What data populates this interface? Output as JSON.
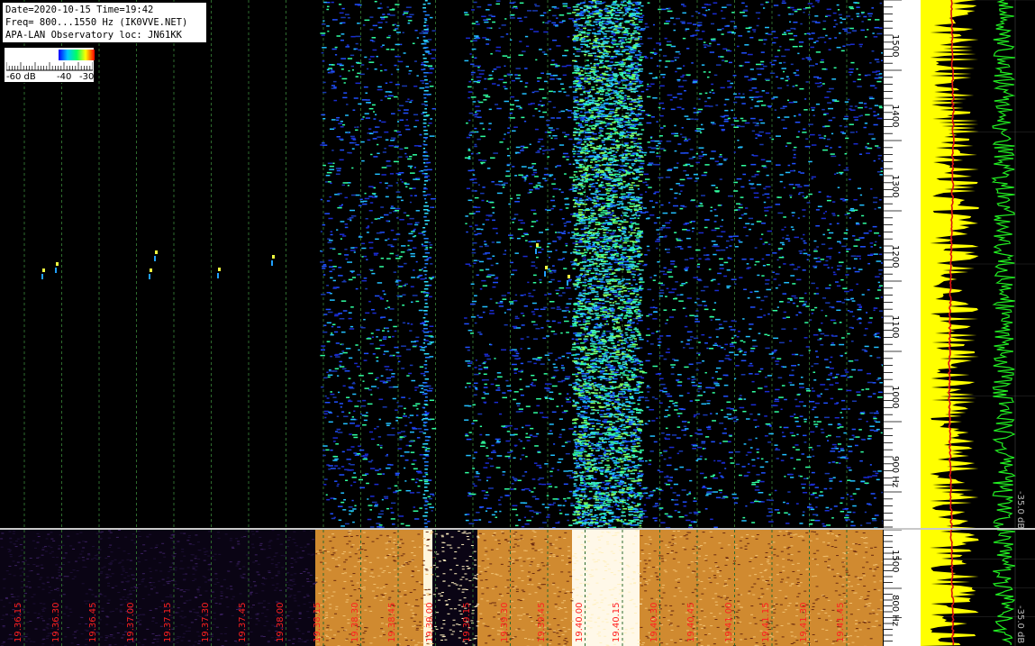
{
  "header": {
    "line1": "Date=2020-10-15 Time=19:42",
    "line2": "Freq= 800...1550 Hz (IK0VVE.NET)",
    "line3": "APA-LAN Observatory loc: JN61KK"
  },
  "legend": {
    "min_label": "-60 dB",
    "mid_label": "-40",
    "max_label": "-30",
    "colors": [
      "#0000ff",
      "#00c8ff",
      "#00ff64",
      "#ffff00",
      "#ff0000"
    ]
  },
  "freq_axis_top": {
    "labels": [
      "1500",
      "1400",
      "1300",
      "1200",
      "1100",
      "1000",
      "900 Hz"
    ]
  },
  "freq_axis_bottom": {
    "labels": [
      "1500",
      "800 Hz"
    ]
  },
  "db_labels": {
    "top": "-35.0 dB",
    "bottom": "-35.0 dB"
  },
  "time_axis": {
    "labels": [
      "19.36.15",
      "19.36.30",
      "19.36.45",
      "19.37.00",
      "19.37.15",
      "19.37.30",
      "19.37.45",
      "19.38.00",
      "19.38.15",
      "19.38.30",
      "19.38.45",
      "19.39.00",
      "19.39.15",
      "19.39.30",
      "19.39.45",
      "19.40.00",
      "19.40.15",
      "19.40.30",
      "19.40.45",
      "19.41.00",
      "19.41.15",
      "19.41.30",
      "19.41.45"
    ]
  },
  "colors": {
    "grid_green": "#2e6b2e",
    "time_label": "#ff2020",
    "spectrum_yellow": "#ffff00",
    "spectrum_green": "#22ee22",
    "spectrum_red": "#dd1111",
    "bg_top": "#000000",
    "bg_bottom": "#0a0414",
    "amber_band": "#d08a30"
  }
}
